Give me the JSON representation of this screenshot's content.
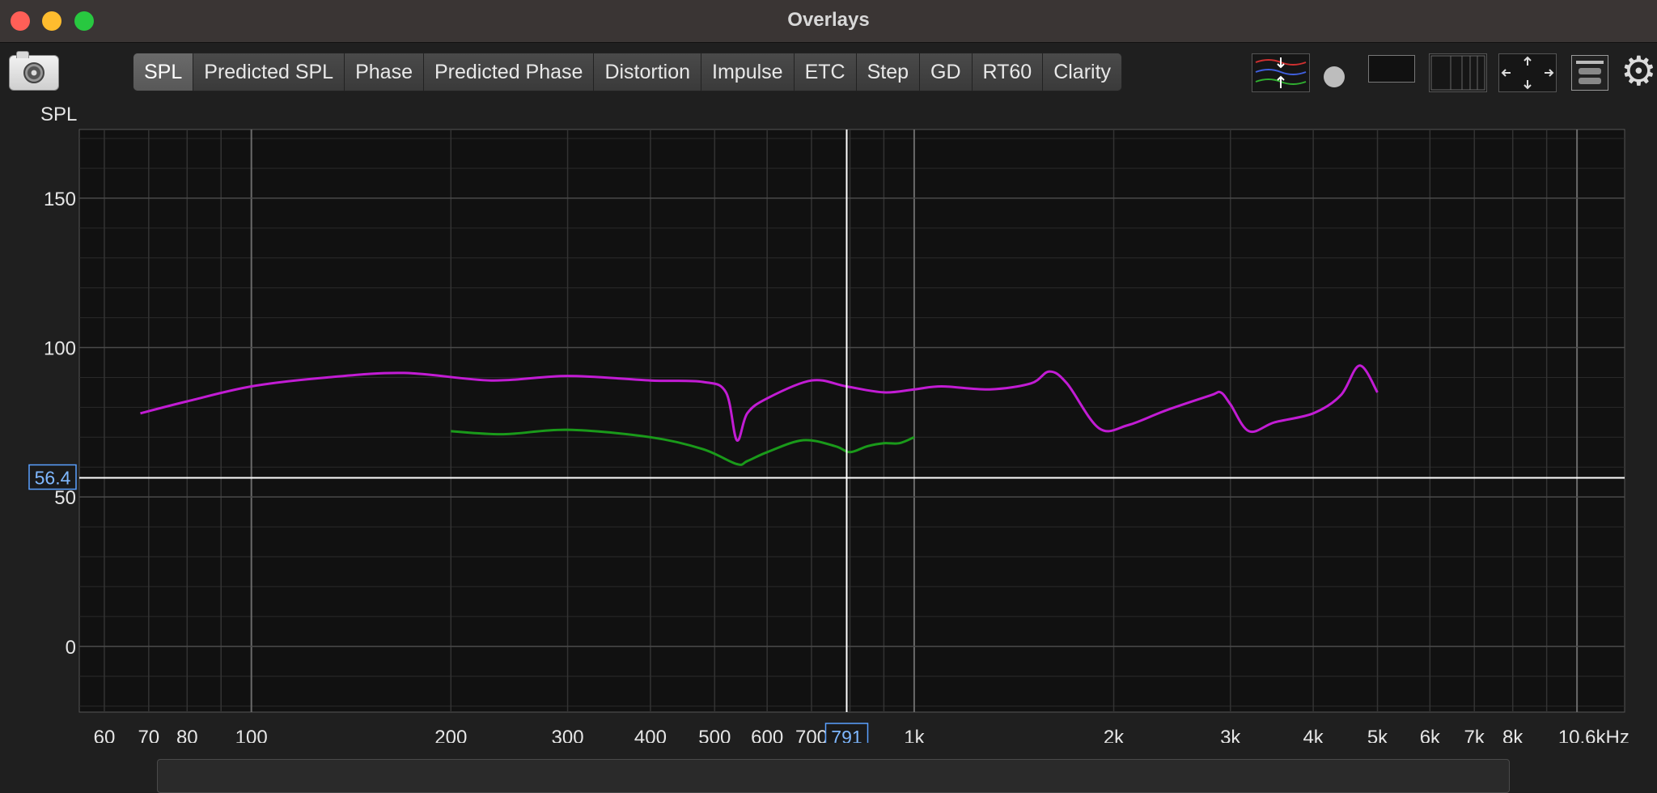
{
  "window": {
    "title": "Overlays"
  },
  "toolbar": {
    "tabs": [
      {
        "label": "SPL",
        "active": true
      },
      {
        "label": "Predicted SPL",
        "active": false
      },
      {
        "label": "Phase",
        "active": false
      },
      {
        "label": "Predicted Phase",
        "active": false
      },
      {
        "label": "Distortion",
        "active": false
      },
      {
        "label": "Impulse",
        "active": false
      },
      {
        "label": "ETC",
        "active": false
      },
      {
        "label": "Step",
        "active": false
      },
      {
        "label": "GD",
        "active": false
      },
      {
        "label": "RT60",
        "active": false
      },
      {
        "label": "Clarity",
        "active": false
      }
    ],
    "icons": [
      "camera-icon",
      "trace-arrange-icon",
      "dot-icon",
      "blank-box-icon",
      "columns-icon",
      "arrows-icon",
      "layout-icon",
      "gear-icon"
    ]
  },
  "chart_data": {
    "type": "line",
    "ylabel": "SPL",
    "xscale": "log",
    "xlim": [
      55,
      11800
    ],
    "ylim": [
      -22,
      173
    ],
    "yticks": [
      0,
      50,
      100,
      150
    ],
    "xticks": [
      {
        "v": 60,
        "label": "60"
      },
      {
        "v": 70,
        "label": "70"
      },
      {
        "v": 80,
        "label": "80"
      },
      {
        "v": 100,
        "label": "100"
      },
      {
        "v": 200,
        "label": "200"
      },
      {
        "v": 300,
        "label": "300"
      },
      {
        "v": 400,
        "label": "400"
      },
      {
        "v": 500,
        "label": "500"
      },
      {
        "v": 600,
        "label": "600"
      },
      {
        "v": 700,
        "label": "700"
      },
      {
        "v": 1000,
        "label": "1k"
      },
      {
        "v": 2000,
        "label": "2k"
      },
      {
        "v": 3000,
        "label": "3k"
      },
      {
        "v": 4000,
        "label": "4k"
      },
      {
        "v": 5000,
        "label": "5k"
      },
      {
        "v": 6000,
        "label": "6k"
      },
      {
        "v": 7000,
        "label": "7k"
      },
      {
        "v": 8000,
        "label": "8k"
      },
      {
        "v": 10600,
        "label": "10.6kHz"
      }
    ],
    "grid": true,
    "cursor": {
      "x": 791,
      "y": 56.4,
      "x_label": "791",
      "y_label": "56.4"
    },
    "series": [
      {
        "color": "#c21cd4",
        "x": [
          68,
          80,
          100,
          130,
          170,
          230,
          300,
          400,
          480,
          520,
          540,
          560,
          600,
          700,
          790,
          900,
          1000,
          1100,
          1300,
          1500,
          1600,
          1700,
          1900,
          2100,
          2400,
          2800,
          2900,
          3000,
          3200,
          3500,
          4000,
          4400,
          4700,
          5000
        ],
        "y": [
          78,
          82,
          87,
          90,
          91.5,
          89,
          90.5,
          89,
          88.5,
          85,
          69,
          78,
          83,
          89,
          87,
          85,
          86,
          87,
          86,
          88,
          92,
          88,
          73,
          74,
          79,
          84,
          85,
          81,
          72,
          75,
          78,
          84,
          94,
          85
        ]
      },
      {
        "color": "#1a9a1a",
        "x": [
          200,
          240,
          300,
          400,
          480,
          540,
          560,
          600,
          680,
          760,
          800,
          850,
          900,
          950,
          1000
        ],
        "y": [
          72,
          71,
          72.5,
          70,
          66,
          61,
          62,
          65,
          69,
          67,
          65,
          67,
          68,
          68,
          70
        ]
      }
    ]
  }
}
